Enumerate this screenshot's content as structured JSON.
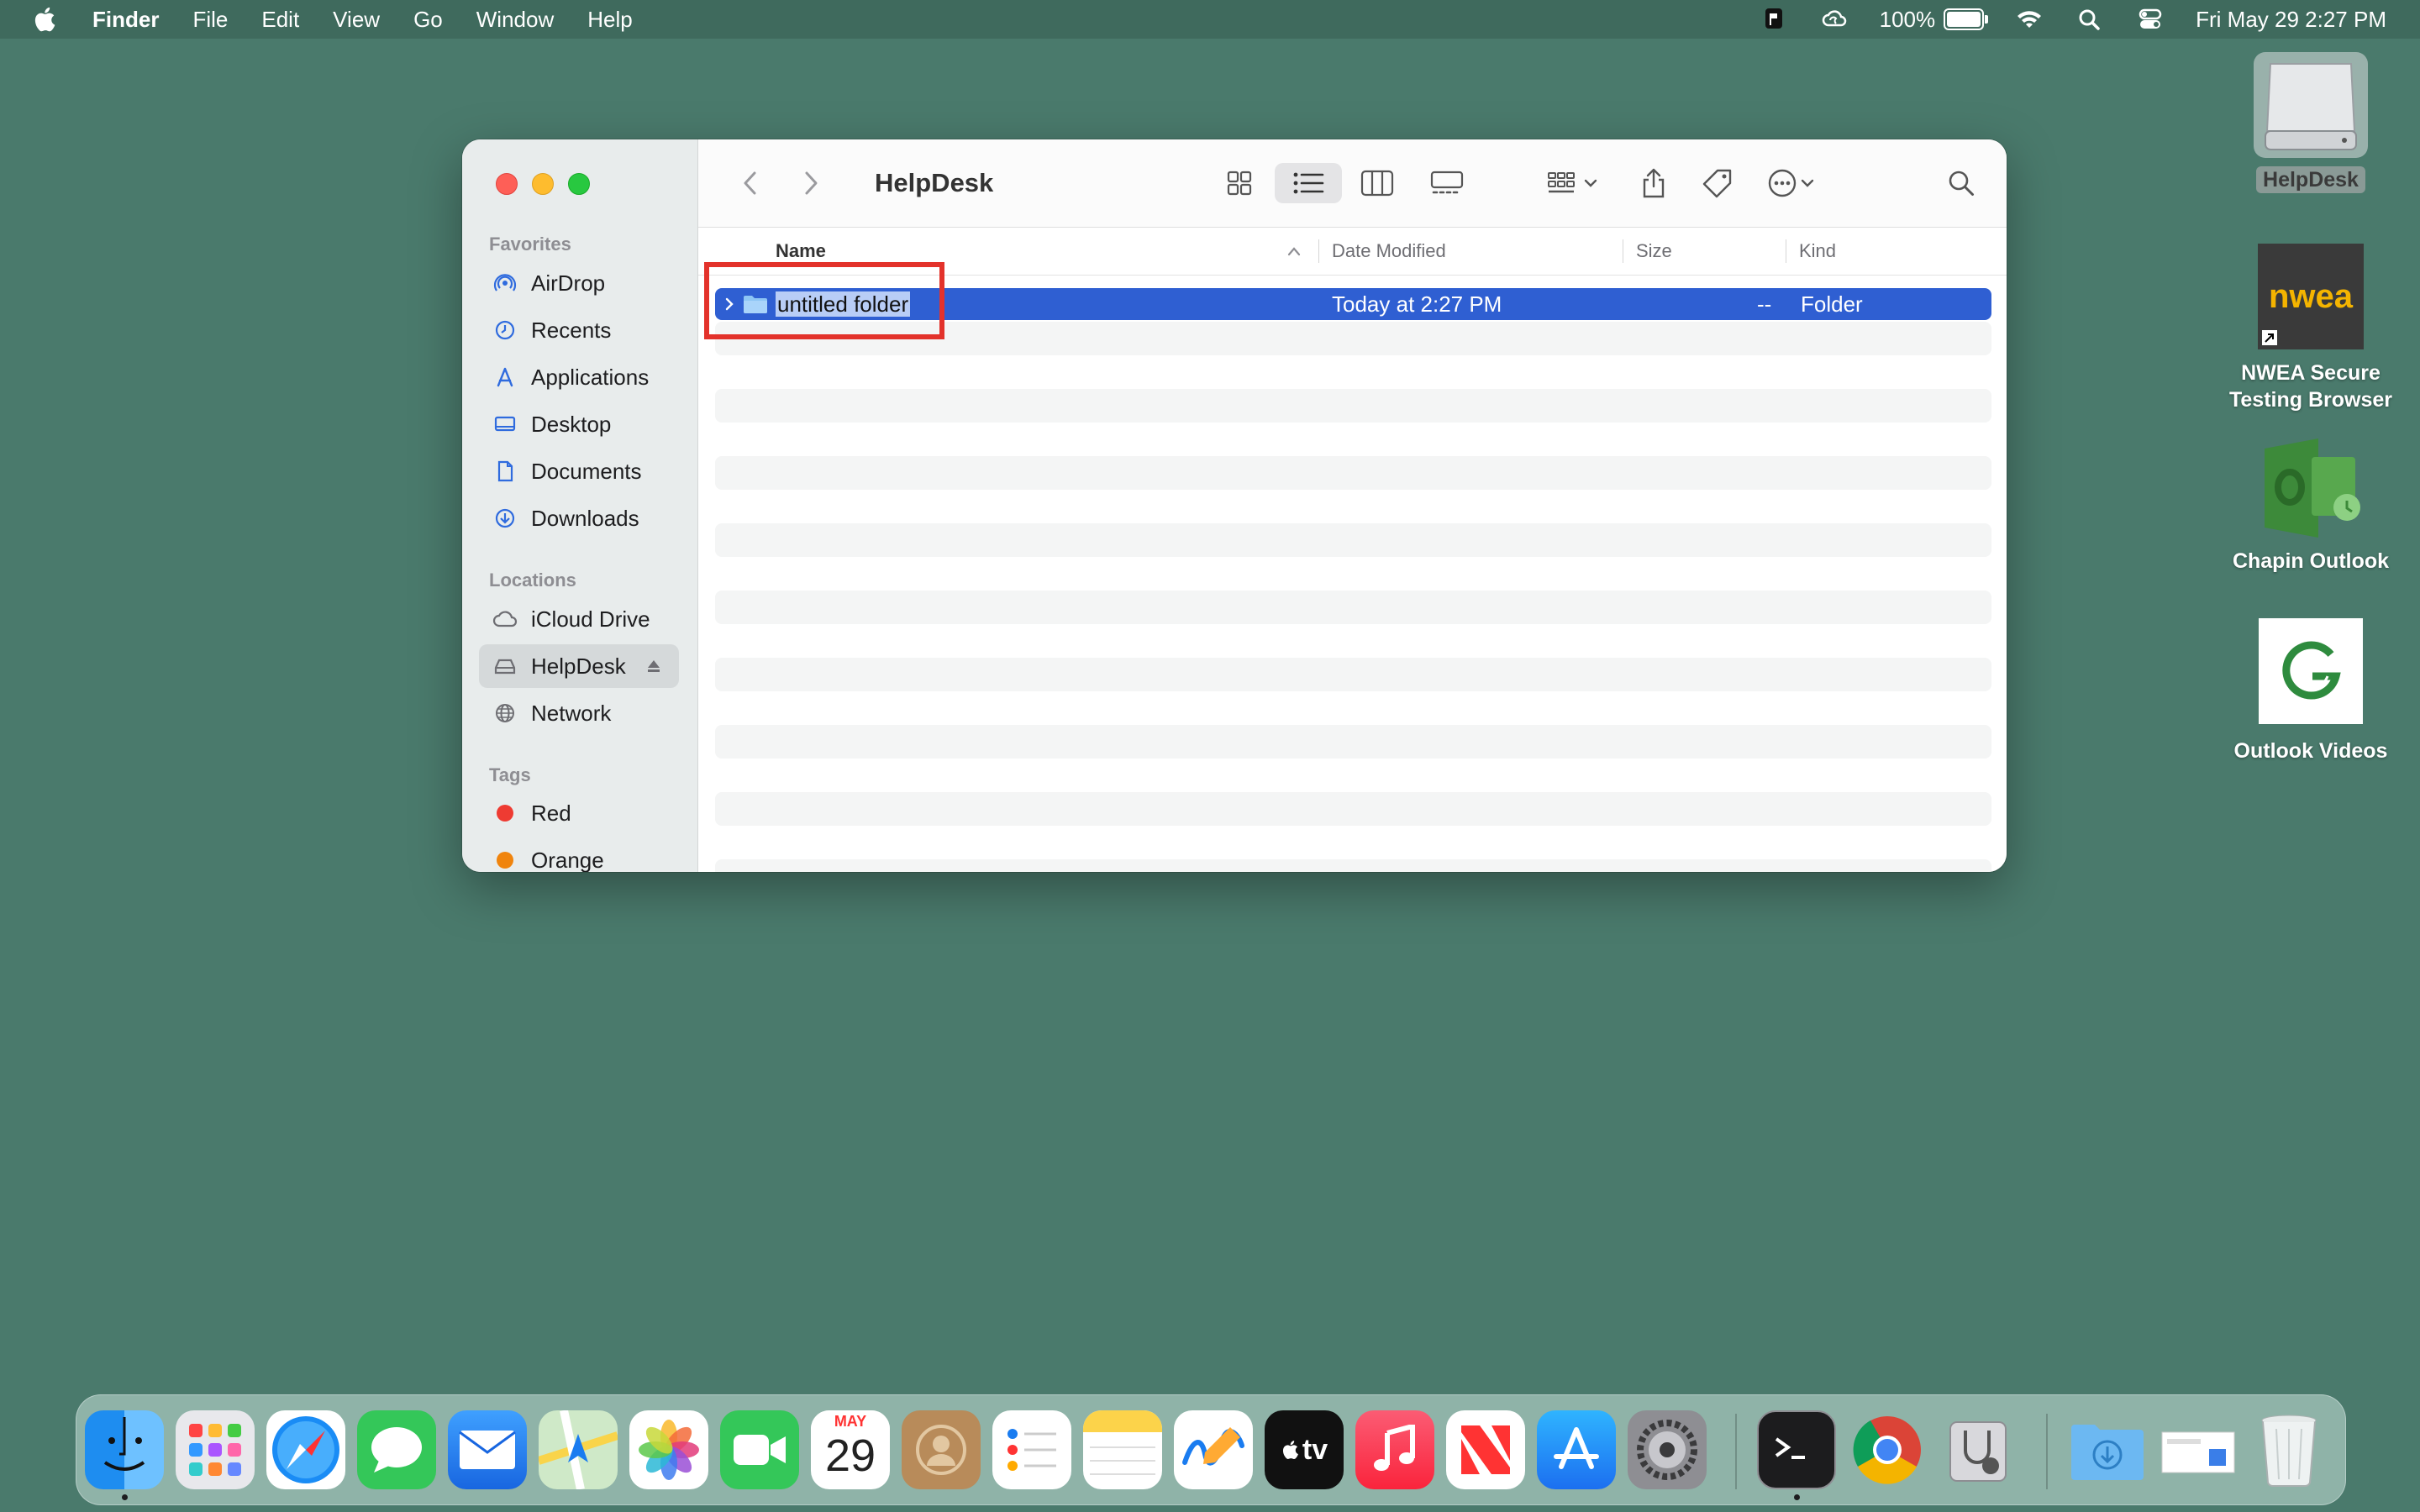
{
  "menubar": {
    "app_name": "Finder",
    "menus": [
      "File",
      "Edit",
      "View",
      "Go",
      "Window",
      "Help"
    ],
    "battery_percent": "100%",
    "battery_level": 1.0,
    "datetime": "Fri May 29  2:27 PM"
  },
  "window": {
    "title": "HelpDesk",
    "sidebar": {
      "favorites_label": "Favorites",
      "favorites": [
        {
          "label": "AirDrop",
          "icon": "airdrop-icon"
        },
        {
          "label": "Recents",
          "icon": "clock-icon"
        },
        {
          "label": "Applications",
          "icon": "applications-icon"
        },
        {
          "label": "Desktop",
          "icon": "desktop-icon"
        },
        {
          "label": "Documents",
          "icon": "document-icon"
        },
        {
          "label": "Downloads",
          "icon": "download-icon"
        }
      ],
      "locations_label": "Locations",
      "locations": [
        {
          "label": "iCloud Drive",
          "icon": "cloud-icon"
        },
        {
          "label": "HelpDesk",
          "icon": "drive-icon",
          "selected": true
        },
        {
          "label": "Network",
          "icon": "globe-icon"
        }
      ],
      "tags_label": "Tags",
      "tags": [
        {
          "label": "Red",
          "color": "#ee3b32"
        },
        {
          "label": "Orange",
          "color": "#f0840d"
        }
      ]
    },
    "columns": {
      "name": "Name",
      "date_modified": "Date Modified",
      "size": "Size",
      "kind": "Kind"
    },
    "rows": [
      {
        "name": "untitled folder",
        "date_modified": "Today at 2:27 PM",
        "size": "--",
        "kind": "Folder"
      }
    ]
  },
  "desktop": {
    "items": [
      {
        "label": "HelpDesk"
      },
      {
        "label": "NWEA Secure Testing Browser",
        "logo_text": "nwea"
      },
      {
        "label": "Chapin Outlook"
      },
      {
        "label": "Outlook Videos"
      }
    ]
  },
  "dock": {
    "calendar_month": "MAY",
    "calendar_day": "29",
    "tv_label": "tv",
    "colors": {
      "accent": "#2f5fd2"
    }
  }
}
